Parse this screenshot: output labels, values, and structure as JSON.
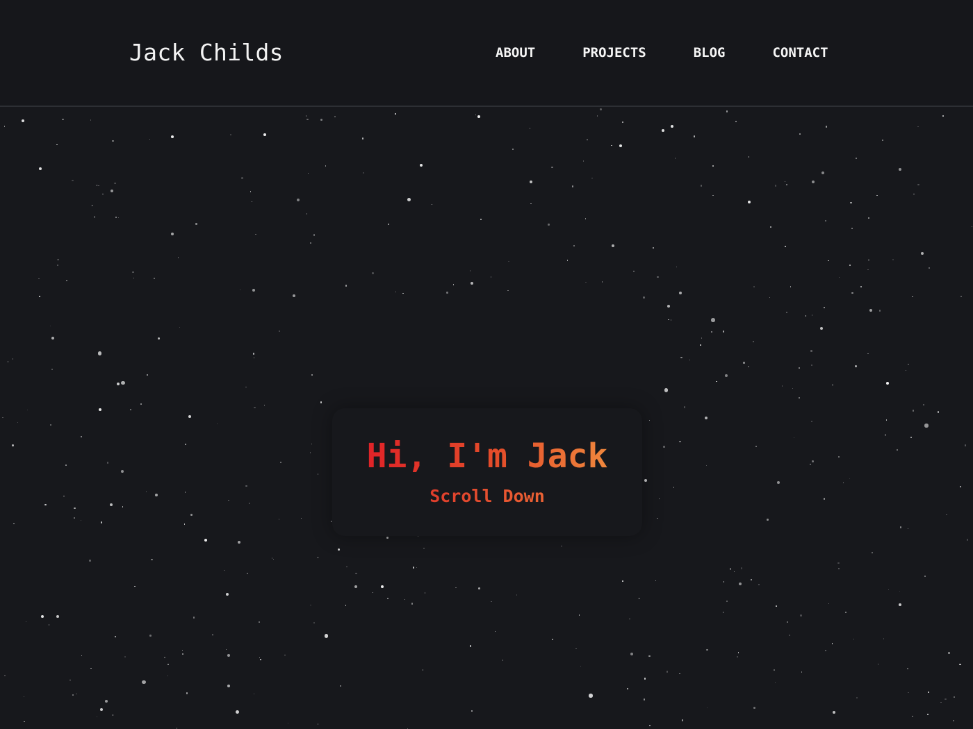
{
  "header": {
    "brand": "Jack Childs",
    "nav": [
      {
        "label": "ABOUT"
      },
      {
        "label": "PROJECTS"
      },
      {
        "label": "BLOG"
      },
      {
        "label": "CONTACT"
      }
    ]
  },
  "hero": {
    "title": "Hi, I'm Jack",
    "subtitle": "Scroll Down"
  },
  "colors": {
    "background": "#17181c",
    "header_background": "#16171b",
    "header_border": "#2d2f34",
    "text": "#f3f3f3",
    "accent_red": "#df2328",
    "accent_orange": "#f0873d"
  }
}
